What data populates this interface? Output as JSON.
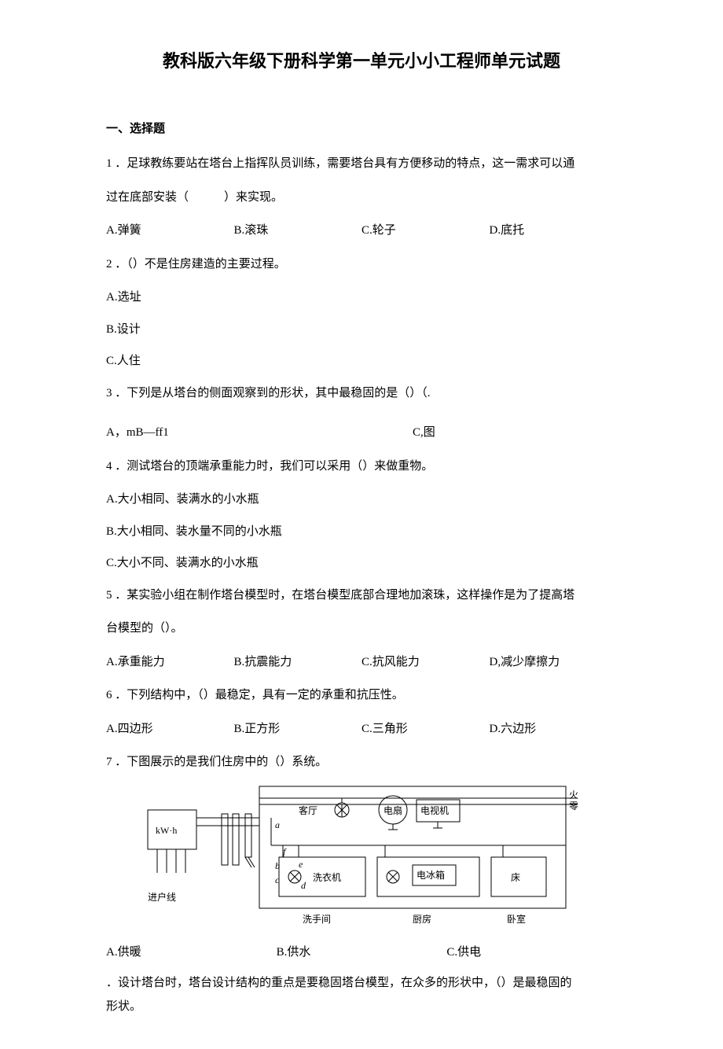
{
  "title": "教科版六年级下册科学第一单元小小工程师单元试题",
  "sectionHeading": "一、选择题",
  "q1": {
    "line1": "1 ．足球教练要站在塔台上指挥队员训练，需要塔台具有方便移动的特点，这一需求可以通",
    "line2": "过在底部安装（　　　）来实现。",
    "a": "A.弹簧",
    "b": "B.滚珠",
    "c": "C.轮子",
    "d": "D.底托"
  },
  "q2": {
    "text": "2 ．（）不是住房建造的主要过程。",
    "a": "A.选址",
    "b": "B.设计",
    "c": "C.人住"
  },
  "q3": {
    "text": "3 ．下列是从塔台的侧面观察到的形状，其中最稳固的是（）（.",
    "left": "A，mB—ff1",
    "right": "C,图"
  },
  "q4": {
    "text": "4 ．测试塔台的顶端承重能力时，我们可以采用（）来做重物。",
    "a": "A.大小相同、装满水的小水瓶",
    "b": "B.大小相同、装水量不同的小水瓶",
    "c": "C.大小不同、装满水的小水瓶"
  },
  "q5": {
    "line1": "5 ．某实验小组在制作塔台模型时，在塔台模型底部合理地加滚珠，这样操作是为了提高塔",
    "line2": "台模型的（）。",
    "a": "A.承重能力",
    "b": "B.抗震能力",
    "c": "C.抗风能力",
    "d": "D,减少摩擦力"
  },
  "q6": {
    "text": "6 ．下列结构中，（）最稳定，具有一定的承重和抗压性。",
    "a": "A.四边形",
    "b": "B.正方形",
    "c": "C.三角形",
    "d": "D.六边形"
  },
  "q7": {
    "text": "7 ．下图展示的是我们住房中的（）系统。",
    "a": "A.供暖",
    "b": "B.供水",
    "c": "C.供电"
  },
  "q8": {
    "line1": "．设计塔台时，塔台设计结构的重点是要稳固塔台模型，在众多的形状中，（）是最稳固的",
    "line2": "形状。"
  },
  "diagram": {
    "kwh": "kW·h",
    "inlet": "进户线",
    "livingRoom": "客厅",
    "fan": "电扇",
    "tv": "电视机",
    "live": "火",
    "neutral": "零",
    "washer": "洗衣机",
    "fridge": "电冰箱",
    "bed": "床",
    "bathroom": "洗手间",
    "kitchen": "厨房",
    "bedroom": "卧室",
    "a": "a",
    "b": "b",
    "c": "c",
    "d": "d",
    "e": "e",
    "f": "f"
  }
}
